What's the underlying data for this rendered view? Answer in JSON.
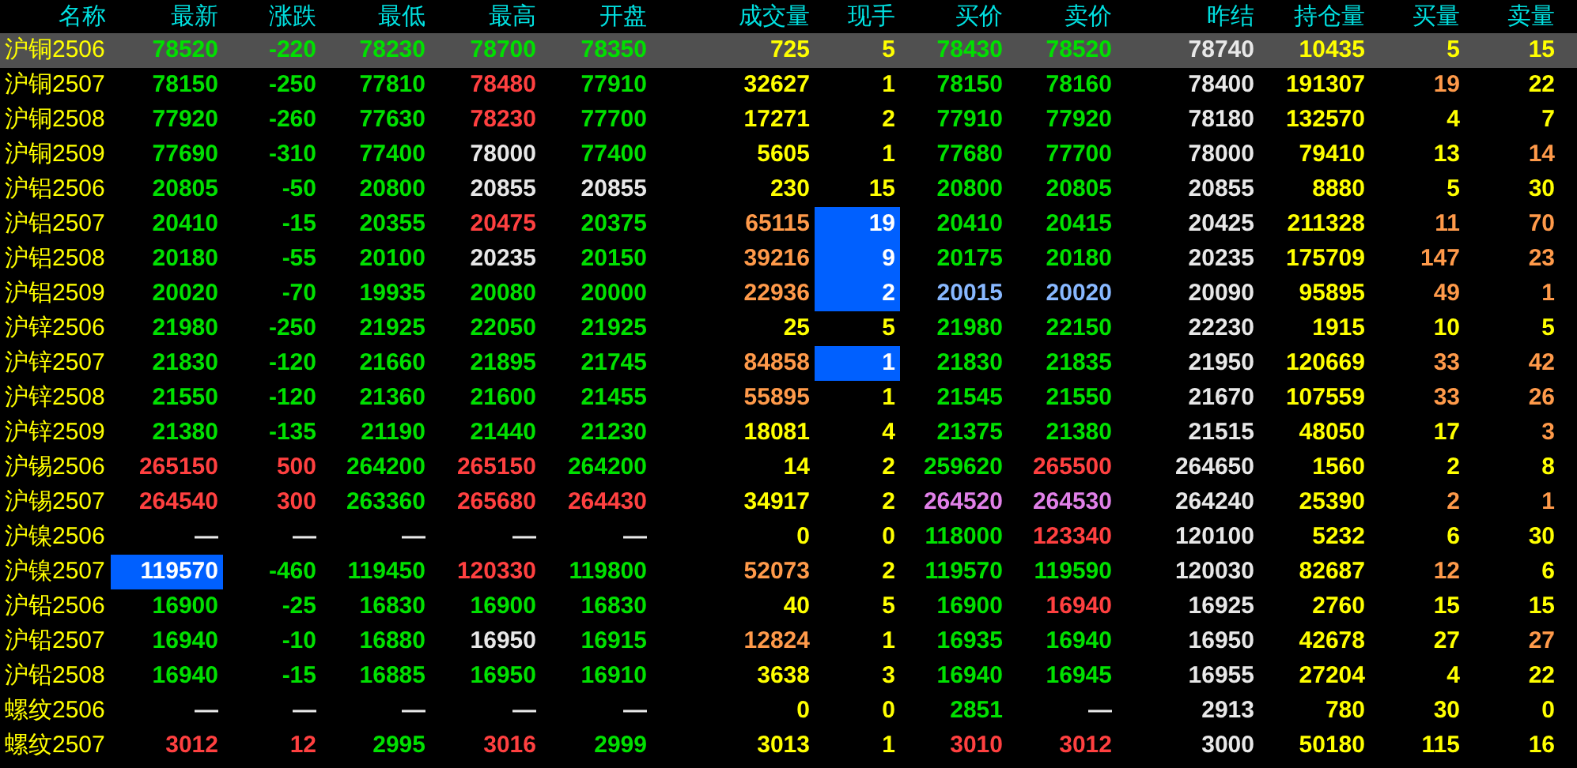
{
  "columns": [
    "名称",
    "最新",
    "涨跌",
    "最低",
    "最高",
    "开盘",
    "成交量",
    "现手",
    "买价",
    "卖价",
    "昨结",
    "持仓量",
    "买量",
    "卖量"
  ],
  "rows": [
    {
      "name": "沪铜2506",
      "selected": true,
      "cells": [
        {
          "text": "78520",
          "color": "#00e000",
          "highlighted": false
        },
        {
          "text": "-220",
          "color": "#00e000",
          "highlighted": false
        },
        {
          "text": "78230",
          "color": "#00e000",
          "highlighted": false
        },
        {
          "text": "78700",
          "color": "#00e000",
          "highlighted": false
        },
        {
          "text": "78350",
          "color": "#00e000",
          "highlighted": false
        },
        {
          "text": "725",
          "color": "#ffff00",
          "highlighted": false
        },
        {
          "text": "5",
          "color": "#ffff00",
          "highlighted": false
        },
        {
          "text": "78430",
          "color": "#00e000",
          "highlighted": false
        },
        {
          "text": "78520",
          "color": "#00e000",
          "highlighted": false
        },
        {
          "text": "78740",
          "color": "#e8e8e8",
          "highlighted": false
        },
        {
          "text": "10435",
          "color": "#ffff00",
          "highlighted": false
        },
        {
          "text": "5",
          "color": "#ffff00",
          "highlighted": false
        },
        {
          "text": "15",
          "color": "#ffff00",
          "highlighted": false
        }
      ]
    },
    {
      "name": "沪铜2507",
      "selected": false,
      "cells": [
        {
          "text": "78150",
          "color": "#00e000",
          "highlighted": false
        },
        {
          "text": "-250",
          "color": "#00e000",
          "highlighted": false
        },
        {
          "text": "77810",
          "color": "#00e000",
          "highlighted": false
        },
        {
          "text": "78480",
          "color": "#ff4040",
          "highlighted": false
        },
        {
          "text": "77910",
          "color": "#00e000",
          "highlighted": false
        },
        {
          "text": "32627",
          "color": "#ffff00",
          "highlighted": false
        },
        {
          "text": "1",
          "color": "#ffff00",
          "highlighted": false
        },
        {
          "text": "78150",
          "color": "#00e000",
          "highlighted": false
        },
        {
          "text": "78160",
          "color": "#00e000",
          "highlighted": false
        },
        {
          "text": "78400",
          "color": "#e8e8e8",
          "highlighted": false
        },
        {
          "text": "191307",
          "color": "#ffff00",
          "highlighted": false
        },
        {
          "text": "19",
          "color": "#ff9a4a",
          "highlighted": false
        },
        {
          "text": "22",
          "color": "#ffff00",
          "highlighted": false
        }
      ]
    },
    {
      "name": "沪铜2508",
      "selected": false,
      "cells": [
        {
          "text": "77920",
          "color": "#00e000",
          "highlighted": false
        },
        {
          "text": "-260",
          "color": "#00e000",
          "highlighted": false
        },
        {
          "text": "77630",
          "color": "#00e000",
          "highlighted": false
        },
        {
          "text": "78230",
          "color": "#ff4040",
          "highlighted": false
        },
        {
          "text": "77700",
          "color": "#00e000",
          "highlighted": false
        },
        {
          "text": "17271",
          "color": "#ffff00",
          "highlighted": false
        },
        {
          "text": "2",
          "color": "#ffff00",
          "highlighted": false
        },
        {
          "text": "77910",
          "color": "#00e000",
          "highlighted": false
        },
        {
          "text": "77920",
          "color": "#00e000",
          "highlighted": false
        },
        {
          "text": "78180",
          "color": "#e8e8e8",
          "highlighted": false
        },
        {
          "text": "132570",
          "color": "#ffff00",
          "highlighted": false
        },
        {
          "text": "4",
          "color": "#ffff00",
          "highlighted": false
        },
        {
          "text": "7",
          "color": "#ffff00",
          "highlighted": false
        }
      ]
    },
    {
      "name": "沪铜2509",
      "selected": false,
      "cells": [
        {
          "text": "77690",
          "color": "#00e000",
          "highlighted": false
        },
        {
          "text": "-310",
          "color": "#00e000",
          "highlighted": false
        },
        {
          "text": "77400",
          "color": "#00e000",
          "highlighted": false
        },
        {
          "text": "78000",
          "color": "#e8e8e8",
          "highlighted": false
        },
        {
          "text": "77400",
          "color": "#00e000",
          "highlighted": false
        },
        {
          "text": "5605",
          "color": "#ffff00",
          "highlighted": false
        },
        {
          "text": "1",
          "color": "#ffff00",
          "highlighted": false
        },
        {
          "text": "77680",
          "color": "#00e000",
          "highlighted": false
        },
        {
          "text": "77700",
          "color": "#00e000",
          "highlighted": false
        },
        {
          "text": "78000",
          "color": "#e8e8e8",
          "highlighted": false
        },
        {
          "text": "79410",
          "color": "#ffff00",
          "highlighted": false
        },
        {
          "text": "13",
          "color": "#ffff00",
          "highlighted": false
        },
        {
          "text": "14",
          "color": "#ff9a4a",
          "highlighted": false
        }
      ]
    },
    {
      "name": "沪铝2506",
      "selected": false,
      "cells": [
        {
          "text": "20805",
          "color": "#00e000",
          "highlighted": false
        },
        {
          "text": "-50",
          "color": "#00e000",
          "highlighted": false
        },
        {
          "text": "20800",
          "color": "#00e000",
          "highlighted": false
        },
        {
          "text": "20855",
          "color": "#e8e8e8",
          "highlighted": false
        },
        {
          "text": "20855",
          "color": "#e8e8e8",
          "highlighted": false
        },
        {
          "text": "230",
          "color": "#ffff00",
          "highlighted": false
        },
        {
          "text": "15",
          "color": "#ffff00",
          "highlighted": false
        },
        {
          "text": "20800",
          "color": "#00e000",
          "highlighted": false
        },
        {
          "text": "20805",
          "color": "#00e000",
          "highlighted": false
        },
        {
          "text": "20855",
          "color": "#e8e8e8",
          "highlighted": false
        },
        {
          "text": "8880",
          "color": "#ffff00",
          "highlighted": false
        },
        {
          "text": "5",
          "color": "#ffff00",
          "highlighted": false
        },
        {
          "text": "30",
          "color": "#ffff00",
          "highlighted": false
        }
      ]
    },
    {
      "name": "沪铝2507",
      "selected": false,
      "cells": [
        {
          "text": "20410",
          "color": "#00e000",
          "highlighted": false
        },
        {
          "text": "-15",
          "color": "#00e000",
          "highlighted": false
        },
        {
          "text": "20355",
          "color": "#00e000",
          "highlighted": false
        },
        {
          "text": "20475",
          "color": "#ff4040",
          "highlighted": false
        },
        {
          "text": "20375",
          "color": "#00e000",
          "highlighted": false
        },
        {
          "text": "65115",
          "color": "#ff9a4a",
          "highlighted": false
        },
        {
          "text": "19",
          "color": "#ffffff",
          "highlighted": true
        },
        {
          "text": "20410",
          "color": "#00e000",
          "highlighted": false
        },
        {
          "text": "20415",
          "color": "#00e000",
          "highlighted": false
        },
        {
          "text": "20425",
          "color": "#e8e8e8",
          "highlighted": false
        },
        {
          "text": "211328",
          "color": "#ffff00",
          "highlighted": false
        },
        {
          "text": "11",
          "color": "#ff9a4a",
          "highlighted": false
        },
        {
          "text": "70",
          "color": "#ff9a4a",
          "highlighted": false
        }
      ]
    },
    {
      "name": "沪铝2508",
      "selected": false,
      "cells": [
        {
          "text": "20180",
          "color": "#00e000",
          "highlighted": false
        },
        {
          "text": "-55",
          "color": "#00e000",
          "highlighted": false
        },
        {
          "text": "20100",
          "color": "#00e000",
          "highlighted": false
        },
        {
          "text": "20235",
          "color": "#e8e8e8",
          "highlighted": false
        },
        {
          "text": "20150",
          "color": "#00e000",
          "highlighted": false
        },
        {
          "text": "39216",
          "color": "#ff9a4a",
          "highlighted": false
        },
        {
          "text": "9",
          "color": "#ffffff",
          "highlighted": true
        },
        {
          "text": "20175",
          "color": "#00e000",
          "highlighted": false
        },
        {
          "text": "20180",
          "color": "#00e000",
          "highlighted": false
        },
        {
          "text": "20235",
          "color": "#e8e8e8",
          "highlighted": false
        },
        {
          "text": "175709",
          "color": "#ffff00",
          "highlighted": false
        },
        {
          "text": "147",
          "color": "#ff9a4a",
          "highlighted": false
        },
        {
          "text": "23",
          "color": "#ff9a4a",
          "highlighted": false
        }
      ]
    },
    {
      "name": "沪铝2509",
      "selected": false,
      "cells": [
        {
          "text": "20020",
          "color": "#00e000",
          "highlighted": false
        },
        {
          "text": "-70",
          "color": "#00e000",
          "highlighted": false
        },
        {
          "text": "19935",
          "color": "#00e000",
          "highlighted": false
        },
        {
          "text": "20080",
          "color": "#00e000",
          "highlighted": false
        },
        {
          "text": "20000",
          "color": "#00e000",
          "highlighted": false
        },
        {
          "text": "22936",
          "color": "#ff9a4a",
          "highlighted": false
        },
        {
          "text": "2",
          "color": "#ffffff",
          "highlighted": true
        },
        {
          "text": "20015",
          "color": "#88b8ff",
          "highlighted": false
        },
        {
          "text": "20020",
          "color": "#88b8ff",
          "highlighted": false
        },
        {
          "text": "20090",
          "color": "#e8e8e8",
          "highlighted": false
        },
        {
          "text": "95895",
          "color": "#ffff00",
          "highlighted": false
        },
        {
          "text": "49",
          "color": "#ff9a4a",
          "highlighted": false
        },
        {
          "text": "1",
          "color": "#ff9a4a",
          "highlighted": false
        }
      ]
    },
    {
      "name": "沪锌2506",
      "selected": false,
      "cells": [
        {
          "text": "21980",
          "color": "#00e000",
          "highlighted": false
        },
        {
          "text": "-250",
          "color": "#00e000",
          "highlighted": false
        },
        {
          "text": "21925",
          "color": "#00e000",
          "highlighted": false
        },
        {
          "text": "22050",
          "color": "#00e000",
          "highlighted": false
        },
        {
          "text": "21925",
          "color": "#00e000",
          "highlighted": false
        },
        {
          "text": "25",
          "color": "#ffff00",
          "highlighted": false
        },
        {
          "text": "5",
          "color": "#ffff00",
          "highlighted": false
        },
        {
          "text": "21980",
          "color": "#00e000",
          "highlighted": false
        },
        {
          "text": "22150",
          "color": "#00e000",
          "highlighted": false
        },
        {
          "text": "22230",
          "color": "#e8e8e8",
          "highlighted": false
        },
        {
          "text": "1915",
          "color": "#ffff00",
          "highlighted": false
        },
        {
          "text": "10",
          "color": "#ffff00",
          "highlighted": false
        },
        {
          "text": "5",
          "color": "#ffff00",
          "highlighted": false
        }
      ]
    },
    {
      "name": "沪锌2507",
      "selected": false,
      "cells": [
        {
          "text": "21830",
          "color": "#00e000",
          "highlighted": false
        },
        {
          "text": "-120",
          "color": "#00e000",
          "highlighted": false
        },
        {
          "text": "21660",
          "color": "#00e000",
          "highlighted": false
        },
        {
          "text": "21895",
          "color": "#00e000",
          "highlighted": false
        },
        {
          "text": "21745",
          "color": "#00e000",
          "highlighted": false
        },
        {
          "text": "84858",
          "color": "#ff9a4a",
          "highlighted": false
        },
        {
          "text": "1",
          "color": "#ffffff",
          "highlighted": true
        },
        {
          "text": "21830",
          "color": "#00e000",
          "highlighted": false
        },
        {
          "text": "21835",
          "color": "#00e000",
          "highlighted": false
        },
        {
          "text": "21950",
          "color": "#e8e8e8",
          "highlighted": false
        },
        {
          "text": "120669",
          "color": "#ffff00",
          "highlighted": false
        },
        {
          "text": "33",
          "color": "#ff9a4a",
          "highlighted": false
        },
        {
          "text": "42",
          "color": "#ff9a4a",
          "highlighted": false
        }
      ]
    },
    {
      "name": "沪锌2508",
      "selected": false,
      "cells": [
        {
          "text": "21550",
          "color": "#00e000",
          "highlighted": false
        },
        {
          "text": "-120",
          "color": "#00e000",
          "highlighted": false
        },
        {
          "text": "21360",
          "color": "#00e000",
          "highlighted": false
        },
        {
          "text": "21600",
          "color": "#00e000",
          "highlighted": false
        },
        {
          "text": "21455",
          "color": "#00e000",
          "highlighted": false
        },
        {
          "text": "55895",
          "color": "#ff9a4a",
          "highlighted": false
        },
        {
          "text": "1",
          "color": "#ffff00",
          "highlighted": false
        },
        {
          "text": "21545",
          "color": "#00e000",
          "highlighted": false
        },
        {
          "text": "21550",
          "color": "#00e000",
          "highlighted": false
        },
        {
          "text": "21670",
          "color": "#e8e8e8",
          "highlighted": false
        },
        {
          "text": "107559",
          "color": "#ffff00",
          "highlighted": false
        },
        {
          "text": "33",
          "color": "#ff9a4a",
          "highlighted": false
        },
        {
          "text": "26",
          "color": "#ff9a4a",
          "highlighted": false
        }
      ]
    },
    {
      "name": "沪锌2509",
      "selected": false,
      "cells": [
        {
          "text": "21380",
          "color": "#00e000",
          "highlighted": false
        },
        {
          "text": "-135",
          "color": "#00e000",
          "highlighted": false
        },
        {
          "text": "21190",
          "color": "#00e000",
          "highlighted": false
        },
        {
          "text": "21440",
          "color": "#00e000",
          "highlighted": false
        },
        {
          "text": "21230",
          "color": "#00e000",
          "highlighted": false
        },
        {
          "text": "18081",
          "color": "#ffff00",
          "highlighted": false
        },
        {
          "text": "4",
          "color": "#ffff00",
          "highlighted": false
        },
        {
          "text": "21375",
          "color": "#00e000",
          "highlighted": false
        },
        {
          "text": "21380",
          "color": "#00e000",
          "highlighted": false
        },
        {
          "text": "21515",
          "color": "#e8e8e8",
          "highlighted": false
        },
        {
          "text": "48050",
          "color": "#ffff00",
          "highlighted": false
        },
        {
          "text": "17",
          "color": "#ffff00",
          "highlighted": false
        },
        {
          "text": "3",
          "color": "#ff9a4a",
          "highlighted": false
        }
      ]
    },
    {
      "name": "沪锡2506",
      "selected": false,
      "cells": [
        {
          "text": "265150",
          "color": "#ff4040",
          "highlighted": false
        },
        {
          "text": "500",
          "color": "#ff4040",
          "highlighted": false
        },
        {
          "text": "264200",
          "color": "#00e000",
          "highlighted": false
        },
        {
          "text": "265150",
          "color": "#ff4040",
          "highlighted": false
        },
        {
          "text": "264200",
          "color": "#00e000",
          "highlighted": false
        },
        {
          "text": "14",
          "color": "#ffff00",
          "highlighted": false
        },
        {
          "text": "2",
          "color": "#ffff00",
          "highlighted": false
        },
        {
          "text": "259620",
          "color": "#00e000",
          "highlighted": false
        },
        {
          "text": "265500",
          "color": "#ff4040",
          "highlighted": false
        },
        {
          "text": "264650",
          "color": "#e8e8e8",
          "highlighted": false
        },
        {
          "text": "1560",
          "color": "#ffff00",
          "highlighted": false
        },
        {
          "text": "2",
          "color": "#ffff00",
          "highlighted": false
        },
        {
          "text": "8",
          "color": "#ffff00",
          "highlighted": false
        }
      ]
    },
    {
      "name": "沪锡2507",
      "selected": false,
      "cells": [
        {
          "text": "264540",
          "color": "#ff4040",
          "highlighted": false
        },
        {
          "text": "300",
          "color": "#ff4040",
          "highlighted": false
        },
        {
          "text": "263360",
          "color": "#00e000",
          "highlighted": false
        },
        {
          "text": "265680",
          "color": "#ff4040",
          "highlighted": false
        },
        {
          "text": "264430",
          "color": "#ff4040",
          "highlighted": false
        },
        {
          "text": "34917",
          "color": "#ffff00",
          "highlighted": false
        },
        {
          "text": "2",
          "color": "#ffff00",
          "highlighted": false
        },
        {
          "text": "264520",
          "color": "#e080e8",
          "highlighted": false
        },
        {
          "text": "264530",
          "color": "#e080e8",
          "highlighted": false
        },
        {
          "text": "264240",
          "color": "#e8e8e8",
          "highlighted": false
        },
        {
          "text": "25390",
          "color": "#ffff00",
          "highlighted": false
        },
        {
          "text": "2",
          "color": "#ff9a4a",
          "highlighted": false
        },
        {
          "text": "1",
          "color": "#ff9a4a",
          "highlighted": false
        }
      ]
    },
    {
      "name": "沪镍2506",
      "selected": false,
      "cells": [
        {
          "text": "—",
          "color": "#e8e8e8",
          "highlighted": false
        },
        {
          "text": "—",
          "color": "#e8e8e8",
          "highlighted": false
        },
        {
          "text": "—",
          "color": "#e8e8e8",
          "highlighted": false
        },
        {
          "text": "—",
          "color": "#e8e8e8",
          "highlighted": false
        },
        {
          "text": "—",
          "color": "#e8e8e8",
          "highlighted": false
        },
        {
          "text": "0",
          "color": "#ffff00",
          "highlighted": false
        },
        {
          "text": "0",
          "color": "#ffff00",
          "highlighted": false
        },
        {
          "text": "118000",
          "color": "#00e000",
          "highlighted": false
        },
        {
          "text": "123340",
          "color": "#ff4040",
          "highlighted": false
        },
        {
          "text": "120100",
          "color": "#e8e8e8",
          "highlighted": false
        },
        {
          "text": "5232",
          "color": "#ffff00",
          "highlighted": false
        },
        {
          "text": "6",
          "color": "#ffff00",
          "highlighted": false
        },
        {
          "text": "30",
          "color": "#ffff00",
          "highlighted": false
        }
      ]
    },
    {
      "name": "沪镍2507",
      "selected": false,
      "cells": [
        {
          "text": "119570",
          "color": "#ffffff",
          "highlighted": true
        },
        {
          "text": "-460",
          "color": "#00e000",
          "highlighted": false
        },
        {
          "text": "119450",
          "color": "#00e000",
          "highlighted": false
        },
        {
          "text": "120330",
          "color": "#ff4040",
          "highlighted": false
        },
        {
          "text": "119800",
          "color": "#00e000",
          "highlighted": false
        },
        {
          "text": "52073",
          "color": "#ff9a4a",
          "highlighted": false
        },
        {
          "text": "2",
          "color": "#ffff00",
          "highlighted": false
        },
        {
          "text": "119570",
          "color": "#00e000",
          "highlighted": false
        },
        {
          "text": "119590",
          "color": "#00e000",
          "highlighted": false
        },
        {
          "text": "120030",
          "color": "#e8e8e8",
          "highlighted": false
        },
        {
          "text": "82687",
          "color": "#ffff00",
          "highlighted": false
        },
        {
          "text": "12",
          "color": "#ff9a4a",
          "highlighted": false
        },
        {
          "text": "6",
          "color": "#ffff00",
          "highlighted": false
        }
      ]
    },
    {
      "name": "沪铅2506",
      "selected": false,
      "cells": [
        {
          "text": "16900",
          "color": "#00e000",
          "highlighted": false
        },
        {
          "text": "-25",
          "color": "#00e000",
          "highlighted": false
        },
        {
          "text": "16830",
          "color": "#00e000",
          "highlighted": false
        },
        {
          "text": "16900",
          "color": "#00e000",
          "highlighted": false
        },
        {
          "text": "16830",
          "color": "#00e000",
          "highlighted": false
        },
        {
          "text": "40",
          "color": "#ffff00",
          "highlighted": false
        },
        {
          "text": "5",
          "color": "#ffff00",
          "highlighted": false
        },
        {
          "text": "16900",
          "color": "#00e000",
          "highlighted": false
        },
        {
          "text": "16940",
          "color": "#ff4040",
          "highlighted": false
        },
        {
          "text": "16925",
          "color": "#e8e8e8",
          "highlighted": false
        },
        {
          "text": "2760",
          "color": "#ffff00",
          "highlighted": false
        },
        {
          "text": "15",
          "color": "#ffff00",
          "highlighted": false
        },
        {
          "text": "15",
          "color": "#ffff00",
          "highlighted": false
        }
      ]
    },
    {
      "name": "沪铅2507",
      "selected": false,
      "cells": [
        {
          "text": "16940",
          "color": "#00e000",
          "highlighted": false
        },
        {
          "text": "-10",
          "color": "#00e000",
          "highlighted": false
        },
        {
          "text": "16880",
          "color": "#00e000",
          "highlighted": false
        },
        {
          "text": "16950",
          "color": "#e8e8e8",
          "highlighted": false
        },
        {
          "text": "16915",
          "color": "#00e000",
          "highlighted": false
        },
        {
          "text": "12824",
          "color": "#ff9a4a",
          "highlighted": false
        },
        {
          "text": "1",
          "color": "#ffff00",
          "highlighted": false
        },
        {
          "text": "16935",
          "color": "#00e000",
          "highlighted": false
        },
        {
          "text": "16940",
          "color": "#00e000",
          "highlighted": false
        },
        {
          "text": "16950",
          "color": "#e8e8e8",
          "highlighted": false
        },
        {
          "text": "42678",
          "color": "#ffff00",
          "highlighted": false
        },
        {
          "text": "27",
          "color": "#ffff00",
          "highlighted": false
        },
        {
          "text": "27",
          "color": "#ff9a4a",
          "highlighted": false
        }
      ]
    },
    {
      "name": "沪铅2508",
      "selected": false,
      "cells": [
        {
          "text": "16940",
          "color": "#00e000",
          "highlighted": false
        },
        {
          "text": "-15",
          "color": "#00e000",
          "highlighted": false
        },
        {
          "text": "16885",
          "color": "#00e000",
          "highlighted": false
        },
        {
          "text": "16950",
          "color": "#00e000",
          "highlighted": false
        },
        {
          "text": "16910",
          "color": "#00e000",
          "highlighted": false
        },
        {
          "text": "3638",
          "color": "#ffff00",
          "highlighted": false
        },
        {
          "text": "3",
          "color": "#ffff00",
          "highlighted": false
        },
        {
          "text": "16940",
          "color": "#00e000",
          "highlighted": false
        },
        {
          "text": "16945",
          "color": "#00e000",
          "highlighted": false
        },
        {
          "text": "16955",
          "color": "#e8e8e8",
          "highlighted": false
        },
        {
          "text": "27204",
          "color": "#ffff00",
          "highlighted": false
        },
        {
          "text": "4",
          "color": "#ffff00",
          "highlighted": false
        },
        {
          "text": "22",
          "color": "#ffff00",
          "highlighted": false
        }
      ]
    },
    {
      "name": "螺纹2506",
      "selected": false,
      "cells": [
        {
          "text": "—",
          "color": "#e8e8e8",
          "highlighted": false
        },
        {
          "text": "—",
          "color": "#e8e8e8",
          "highlighted": false
        },
        {
          "text": "—",
          "color": "#e8e8e8",
          "highlighted": false
        },
        {
          "text": "—",
          "color": "#e8e8e8",
          "highlighted": false
        },
        {
          "text": "—",
          "color": "#e8e8e8",
          "highlighted": false
        },
        {
          "text": "0",
          "color": "#ffff00",
          "highlighted": false
        },
        {
          "text": "0",
          "color": "#ffff00",
          "highlighted": false
        },
        {
          "text": "2851",
          "color": "#00e000",
          "highlighted": false
        },
        {
          "text": "—",
          "color": "#e8e8e8",
          "highlighted": false
        },
        {
          "text": "2913",
          "color": "#e8e8e8",
          "highlighted": false
        },
        {
          "text": "780",
          "color": "#ffff00",
          "highlighted": false
        },
        {
          "text": "30",
          "color": "#ffff00",
          "highlighted": false
        },
        {
          "text": "0",
          "color": "#ffff00",
          "highlighted": false
        }
      ]
    },
    {
      "name": "螺纹2507",
      "selected": false,
      "cells": [
        {
          "text": "3012",
          "color": "#ff4040",
          "highlighted": false
        },
        {
          "text": "12",
          "color": "#ff4040",
          "highlighted": false
        },
        {
          "text": "2995",
          "color": "#00e000",
          "highlighted": false
        },
        {
          "text": "3016",
          "color": "#ff4040",
          "highlighted": false
        },
        {
          "text": "2999",
          "color": "#00e000",
          "highlighted": false
        },
        {
          "text": "3013",
          "color": "#ffff00",
          "highlighted": false
        },
        {
          "text": "1",
          "color": "#ffff00",
          "highlighted": false
        },
        {
          "text": "3010",
          "color": "#ff4040",
          "highlighted": false
        },
        {
          "text": "3012",
          "color": "#ff4040",
          "highlighted": false
        },
        {
          "text": "3000",
          "color": "#e8e8e8",
          "highlighted": false
        },
        {
          "text": "50180",
          "color": "#ffff00",
          "highlighted": false
        },
        {
          "text": "115",
          "color": "#ffff00",
          "highlighted": false
        },
        {
          "text": "16",
          "color": "#ffff00",
          "highlighted": false
        }
      ]
    }
  ]
}
